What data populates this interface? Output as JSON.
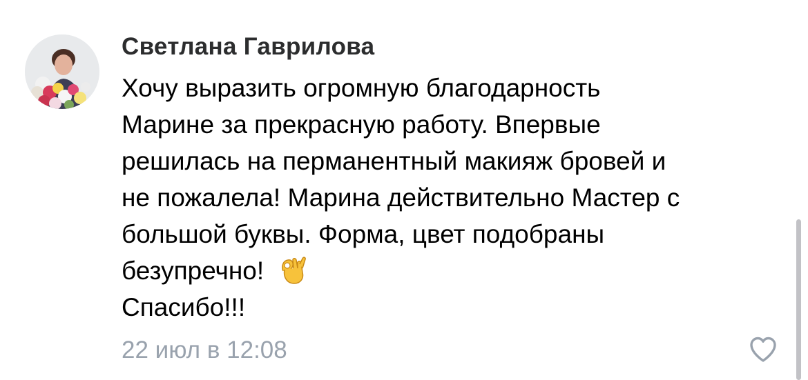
{
  "comment": {
    "author": "Светлана Гаврилова",
    "avatar_icon": "user-avatar-photo",
    "text_lines": [
      "Хочу выразить огромную благодарность",
      "Марине за прекрасную работу. Впервые",
      "решилась на перманентный макияж бровей и",
      "не пожалела! Марина действительно Мастер с",
      "большой буквы. Форма, цвет подобраны",
      "безупречно!",
      "Спасибо!!!"
    ],
    "emoji_icon": "ok-hand-icon",
    "timestamp": "22 июл в 12:08",
    "like_icon": "heart-outline-icon"
  },
  "colors": {
    "author": "#2c2d2e",
    "text": "#000000",
    "timestamp": "#99a2ad",
    "like_icon": "#99a2ad",
    "scrollbar": "#c2c2c6"
  }
}
